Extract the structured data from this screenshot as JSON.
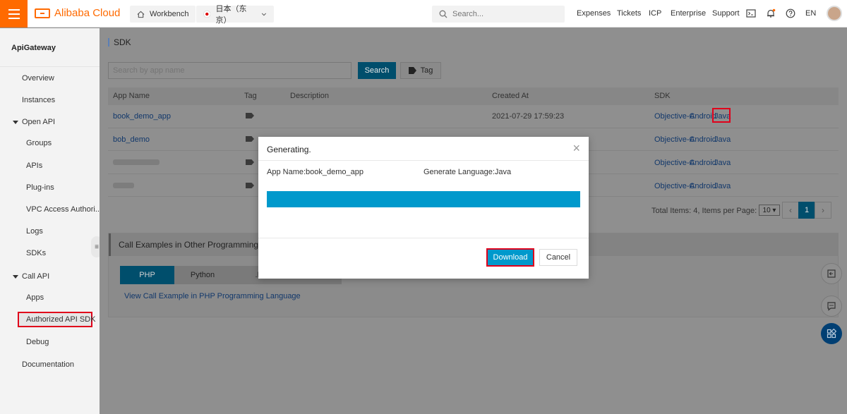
{
  "topbar": {
    "brand": "Alibaba Cloud",
    "workbench": "Workbench",
    "region": "日本（东京）",
    "search_placeholder": "Search...",
    "links": [
      "Expenses",
      "Tickets",
      "ICP",
      "Enterprise",
      "Support"
    ],
    "language": "EN"
  },
  "sidebar": {
    "product": "ApiGateway",
    "items": {
      "overview": "Overview",
      "instances": "Instances",
      "open_api": "Open API",
      "groups": "Groups",
      "apis": "APIs",
      "plugins": "Plug-ins",
      "vpc": "VPC Access Authori...",
      "logs": "Logs",
      "sdks": "SDKs",
      "call_api": "Call API",
      "apps": "Apps",
      "authorized_sdk": "Authorized API SDK",
      "debug": "Debug",
      "documentation": "Documentation"
    }
  },
  "main": {
    "breadcrumb": "SDK",
    "search_placeholder": "Search by app name",
    "search_button": "Search",
    "tag_button": "Tag",
    "columns": [
      "App Name",
      "Tag",
      "Description",
      "Created At",
      "SDK"
    ],
    "rows": [
      {
        "app": "book_demo_app",
        "created": "2021-07-29 17:59:23",
        "sdk": [
          "Objective-C",
          "Android",
          "Java"
        ]
      },
      {
        "app": "bob_demo",
        "created": "",
        "sdk": [
          "Objective-C",
          "Android",
          "Java"
        ]
      },
      {
        "app": "",
        "created": "",
        "sdk": [
          "Objective-C",
          "Android",
          "Java"
        ]
      },
      {
        "app": "",
        "created": "",
        "sdk": [
          "Objective-C",
          "Android",
          "Java"
        ]
      }
    ],
    "pager": {
      "info": "Total Items: 4, Items per Page: 10",
      "per_page": "10",
      "prev": "‹",
      "current": "1",
      "next": "›"
    },
    "examples": {
      "title": "Call Examples in Other Programming Langu",
      "tabs": [
        "PHP",
        "Python",
        ".N"
      ],
      "link": "View Call Example in PHP Programming Language"
    }
  },
  "dialog": {
    "title": "Generating.",
    "close": "×",
    "app_name": "App Name:book_demo_app",
    "language": "Generate Language:Java",
    "progress": 1.0,
    "download": "Download",
    "cancel": "Cancel"
  },
  "colors": {
    "brand": "#ff6a00",
    "primary": "#0099cc",
    "highlight": "#e0001b"
  }
}
